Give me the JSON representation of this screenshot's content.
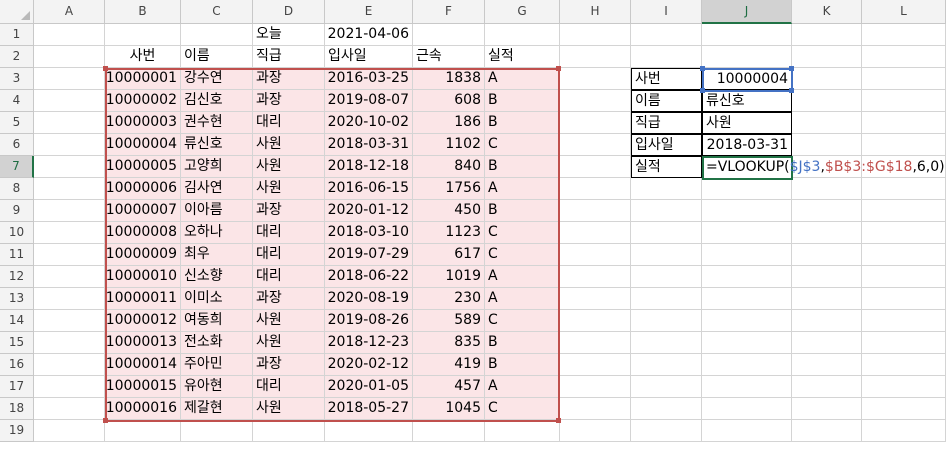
{
  "columns": [
    "A",
    "B",
    "C",
    "D",
    "E",
    "F",
    "G",
    "H",
    "I",
    "J",
    "K",
    "L"
  ],
  "rows": [
    "1",
    "2",
    "3",
    "4",
    "5",
    "6",
    "7",
    "8",
    "9",
    "10",
    "11",
    "12",
    "13",
    "14",
    "15",
    "16",
    "17",
    "18",
    "19"
  ],
  "today": {
    "label": "오늘",
    "value": "2021-04-06"
  },
  "table": {
    "headers": [
      "사번",
      "이름",
      "직급",
      "입사일",
      "근속",
      "실적"
    ],
    "rows": [
      [
        "10000001",
        "강수연",
        "과장",
        "2016-03-25",
        "1838",
        "A"
      ],
      [
        "10000002",
        "김신호",
        "과장",
        "2019-08-07",
        "608",
        "B"
      ],
      [
        "10000003",
        "권수현",
        "대리",
        "2020-10-02",
        "186",
        "B"
      ],
      [
        "10000004",
        "류신호",
        "사원",
        "2018-03-31",
        "1102",
        "C"
      ],
      [
        "10000005",
        "고양희",
        "사원",
        "2018-12-18",
        "840",
        "B"
      ],
      [
        "10000006",
        "김사연",
        "사원",
        "2016-06-15",
        "1756",
        "A"
      ],
      [
        "10000007",
        "이아름",
        "과장",
        "2020-01-12",
        "450",
        "B"
      ],
      [
        "10000008",
        "오하나",
        "대리",
        "2018-03-10",
        "1123",
        "C"
      ],
      [
        "10000009",
        "최우",
        "대리",
        "2019-07-29",
        "617",
        "C"
      ],
      [
        "10000010",
        "신소향",
        "대리",
        "2018-06-22",
        "1019",
        "A"
      ],
      [
        "10000011",
        "이미소",
        "과장",
        "2020-08-19",
        "230",
        "A"
      ],
      [
        "10000012",
        "여동희",
        "사원",
        "2019-08-26",
        "589",
        "C"
      ],
      [
        "10000013",
        "전소화",
        "사원",
        "2018-12-23",
        "835",
        "B"
      ],
      [
        "10000014",
        "주아민",
        "과장",
        "2020-02-12",
        "419",
        "B"
      ],
      [
        "10000015",
        "유아현",
        "대리",
        "2020-01-05",
        "457",
        "A"
      ],
      [
        "10000016",
        "제갈현",
        "사원",
        "2018-05-27",
        "1045",
        "C"
      ]
    ]
  },
  "lookup": {
    "labels": [
      "사번",
      "이름",
      "직급",
      "입사일",
      "실적"
    ],
    "emp_id": "10000004",
    "name": "류신호",
    "position": "사원",
    "hire_date": "2018-03-31"
  },
  "formula": {
    "prefix": "=VLOOKUP(",
    "ref1": "$J$3",
    "sep1": ",",
    "ref2": "$B$3:$G$18",
    "suffix": ",6,0)"
  },
  "active_cell": "J7",
  "colors": {
    "range_border": "#c0504d",
    "range_fill": "#fbe5e7",
    "ref_border": "#4472c4",
    "active_border": "#217346"
  }
}
